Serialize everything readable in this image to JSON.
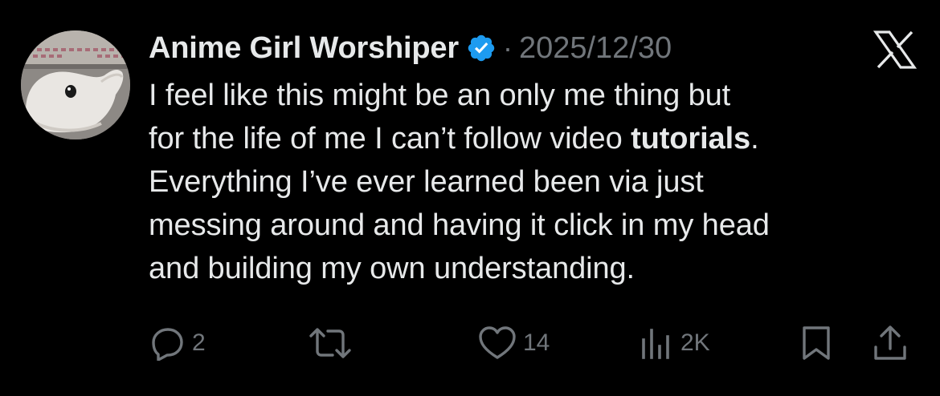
{
  "author": {
    "display_name": "Anime Girl Worshiper",
    "verified": true,
    "separator": "·",
    "date": "2025/12/30"
  },
  "tweet": {
    "lines": [
      {
        "text": "I feel like this might be an only me thing but"
      },
      {
        "pre": "for the life of me I can’t follow video ",
        "bold": "tutorials",
        "post": "."
      },
      {
        "text": "Everything I’ve ever learned been via just"
      },
      {
        "text": "messing around and having it click in my head"
      },
      {
        "text": "and building my own understanding."
      }
    ]
  },
  "actions": {
    "replies": "2",
    "retweets": "",
    "likes": "14",
    "views": "2K"
  },
  "icons": {
    "platform": "x-logo-icon",
    "verified": "verified-badge-icon",
    "reply": "reply-icon",
    "retweet": "retweet-icon",
    "like": "heart-icon",
    "views": "views-icon",
    "bookmark": "bookmark-icon",
    "share": "share-icon"
  },
  "colors": {
    "background": "#000000",
    "text": "#e7e9ea",
    "muted": "#71767b",
    "verified": "#1d9bf0"
  }
}
